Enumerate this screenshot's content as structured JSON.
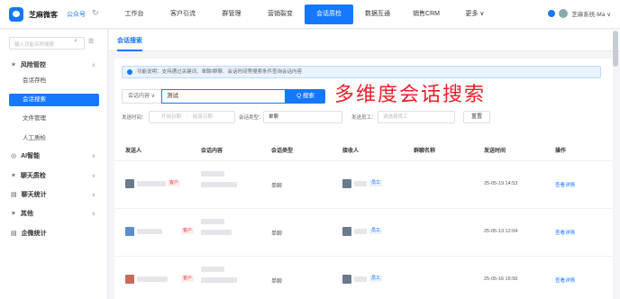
{
  "header": {
    "brand": "芝麻微客",
    "account_type": "公众号",
    "nav": [
      "工作台",
      "客户引流",
      "群管理",
      "营销裂变",
      "会话质检",
      "数据互通",
      "销售CRM",
      "更多 ∨"
    ],
    "active_nav": "会话质检",
    "user": "芝麻系统-Ma ∨"
  },
  "sidebar": {
    "search_placeholder": "输入功能名称搜索",
    "groups": [
      {
        "label": "风险管控",
        "icon": "shield-icon"
      },
      {
        "label": "AI智能",
        "icon": "ai-icon"
      },
      {
        "label": "聊天质检",
        "icon": "check-icon"
      },
      {
        "label": "聊天统计",
        "icon": "chart-icon"
      },
      {
        "label": "其他",
        "icon": "other-icon"
      },
      {
        "label": "企微统计",
        "icon": "stats-icon"
      }
    ],
    "sub_items": [
      "会话存档",
      "会话搜索",
      "文件管理",
      "人工质检"
    ],
    "active_sub": "会话搜索"
  },
  "main": {
    "tab": "会话搜索",
    "notice": "功能说明：支持通过关键词、单聊/群聊、会话时间等搜索条件查询会话内容",
    "search": {
      "scope": "会话内容 ∨",
      "keyword": "测试",
      "button": "Q 搜索"
    },
    "overlay_title": "多维度会话搜索",
    "filters": {
      "time_label": "发送时间：",
      "start_placeholder": "开始日期",
      "end_placeholder": "结束日期",
      "type_label": "会话类型：",
      "type_value": "单聊",
      "staff_label": "发送员工：",
      "staff_placeholder": "请选择员工",
      "reset": "重置"
    },
    "table": {
      "headers": [
        "发送人",
        "会话内容",
        "会话类型",
        "接收人",
        "群聊名称",
        "发送时间",
        "操作"
      ],
      "rows": [
        {
          "type": "单聊",
          "receiver_tag": "员工",
          "sender_tag": "客户",
          "time": "25-05-19 14:53",
          "action": "查看详情"
        },
        {
          "type": "单聊",
          "receiver_tag": "员工",
          "sender_tag": "客户",
          "time": "25-05-13 12:04",
          "action": "查看详情"
        },
        {
          "type": "单聊",
          "receiver_tag": "员工",
          "sender_tag": "客户",
          "time": "25-05-16 16:56",
          "action": "查看详情"
        }
      ]
    }
  }
}
